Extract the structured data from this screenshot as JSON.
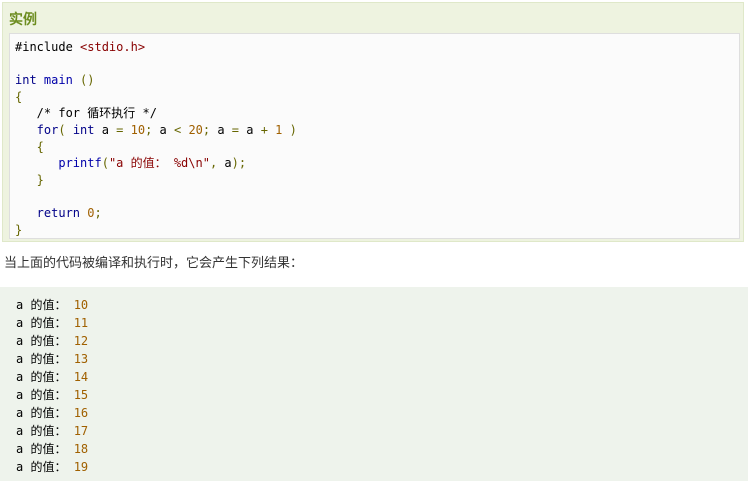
{
  "example": {
    "heading": "实例"
  },
  "code": {
    "lines": [
      {
        "parts": [
          {
            "t": "#include ",
            "c": "pp"
          },
          {
            "t": "<stdio.h>",
            "c": "lib"
          }
        ]
      },
      {
        "parts": []
      },
      {
        "parts": [
          {
            "t": "int ",
            "c": "kw"
          },
          {
            "t": "main",
            "c": "fn"
          },
          {
            "t": " ()",
            "c": "pun"
          }
        ]
      },
      {
        "parts": [
          {
            "t": "{",
            "c": "pun"
          }
        ]
      },
      {
        "parts": [
          {
            "t": "   /* for 循环执行 */",
            "c": "var"
          }
        ]
      },
      {
        "parts": [
          {
            "t": "   for",
            "c": "kw"
          },
          {
            "t": "( ",
            "c": "pun"
          },
          {
            "t": "int ",
            "c": "kw"
          },
          {
            "t": "a ",
            "c": "var"
          },
          {
            "t": "= ",
            "c": "op"
          },
          {
            "t": "10",
            "c": "num"
          },
          {
            "t": "; ",
            "c": "pun"
          },
          {
            "t": "a ",
            "c": "var"
          },
          {
            "t": "< ",
            "c": "op"
          },
          {
            "t": "20",
            "c": "num"
          },
          {
            "t": "; ",
            "c": "pun"
          },
          {
            "t": "a ",
            "c": "var"
          },
          {
            "t": "= ",
            "c": "op"
          },
          {
            "t": "a ",
            "c": "var"
          },
          {
            "t": "+ ",
            "c": "op"
          },
          {
            "t": "1",
            "c": "num"
          },
          {
            "t": " )",
            "c": "pun"
          }
        ]
      },
      {
        "parts": [
          {
            "t": "   {",
            "c": "pun"
          }
        ]
      },
      {
        "parts": [
          {
            "t": "      printf",
            "c": "fn"
          },
          {
            "t": "(",
            "c": "pun"
          },
          {
            "t": "\"a 的值： %d\\n\"",
            "c": "str"
          },
          {
            "t": ", ",
            "c": "pun"
          },
          {
            "t": "a",
            "c": "var"
          },
          {
            "t": ");",
            "c": "pun"
          }
        ]
      },
      {
        "parts": [
          {
            "t": "   }",
            "c": "pun"
          }
        ]
      },
      {
        "parts": []
      },
      {
        "parts": [
          {
            "t": "   return ",
            "c": "kw"
          },
          {
            "t": "0",
            "c": "num"
          },
          {
            "t": ";",
            "c": "pun"
          }
        ]
      },
      {
        "parts": [
          {
            "t": "}",
            "c": "pun"
          }
        ]
      }
    ]
  },
  "result_text": "当上面的代码被编译和执行时，它会产生下列结果：",
  "output": {
    "lines": [
      {
        "var": "a",
        "label": " 的值： ",
        "num": "10"
      },
      {
        "var": "a",
        "label": " 的值： ",
        "num": "11"
      },
      {
        "var": "a",
        "label": " 的值： ",
        "num": "12"
      },
      {
        "var": "a",
        "label": " 的值： ",
        "num": "13"
      },
      {
        "var": "a",
        "label": " 的值： ",
        "num": "14"
      },
      {
        "var": "a",
        "label": " 的值： ",
        "num": "15"
      },
      {
        "var": "a",
        "label": " 的值： ",
        "num": "16"
      },
      {
        "var": "a",
        "label": " 的值： ",
        "num": "17"
      },
      {
        "var": "a",
        "label": " 的值： ",
        "num": "18"
      },
      {
        "var": "a",
        "label": " 的值： ",
        "num": "19"
      }
    ]
  }
}
